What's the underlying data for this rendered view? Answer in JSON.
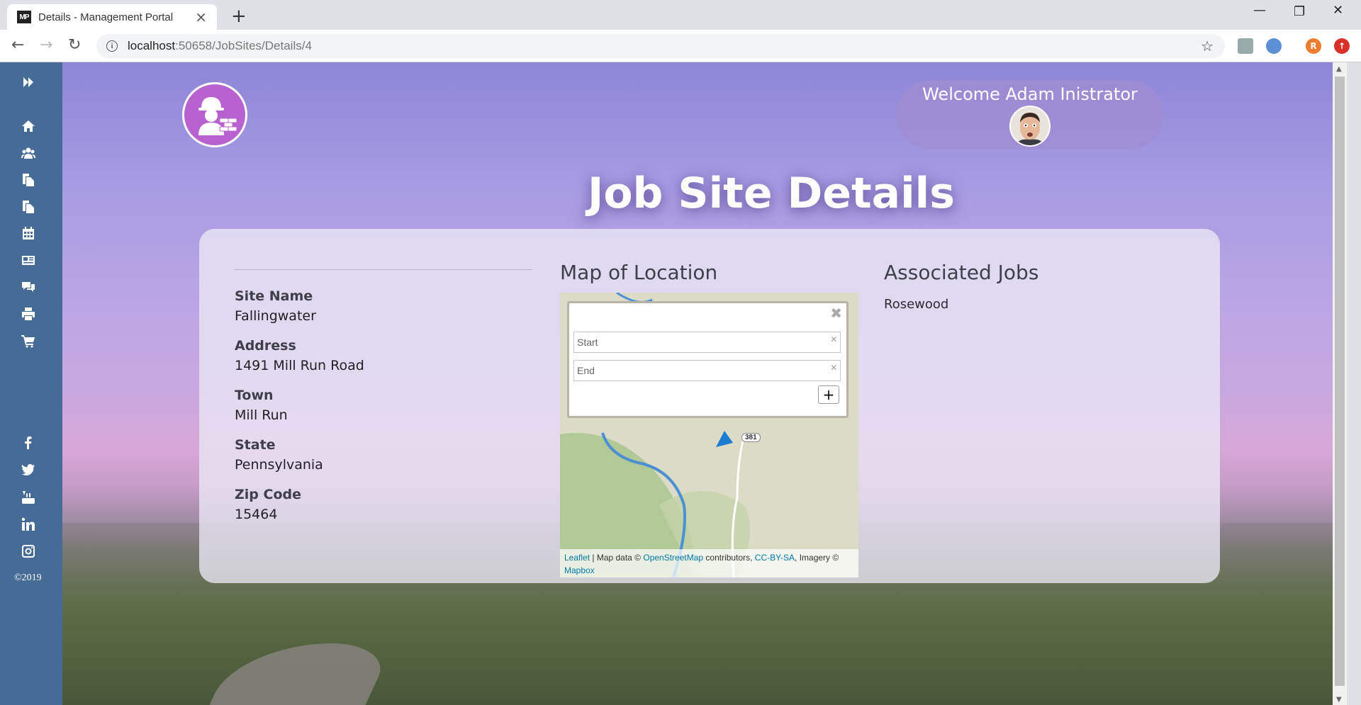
{
  "browser": {
    "tab_title": "Details - Management Portal",
    "favicon_text": "MP",
    "url_host": "localhost",
    "url_rest": ":50658/JobSites/Details/4",
    "profile_initial": "R"
  },
  "sidebar": {
    "items": [
      {
        "icon": "chevron-double-right-icon"
      },
      {
        "icon": "home-icon"
      },
      {
        "icon": "users-icon"
      },
      {
        "icon": "copy-icon"
      },
      {
        "icon": "copy-icon"
      },
      {
        "icon": "calendar-icon"
      },
      {
        "icon": "newspaper-icon"
      },
      {
        "icon": "comments-icon"
      },
      {
        "icon": "print-icon"
      },
      {
        "icon": "cart-icon"
      }
    ],
    "social": [
      "facebook-icon",
      "twitter-icon",
      "youtube-icon",
      "linkedin-icon",
      "instagram-icon"
    ],
    "copyright": "©2019"
  },
  "header": {
    "welcome": "Welcome Adam Inistrator"
  },
  "page": {
    "title": "Job Site Details"
  },
  "details": {
    "fields": [
      {
        "label": "Site Name",
        "value": "Fallingwater"
      },
      {
        "label": "Address",
        "value": "1491 Mill Run Road"
      },
      {
        "label": "Town",
        "value": "Mill Run"
      },
      {
        "label": "State",
        "value": "Pennsylvania"
      },
      {
        "label": "Zip Code",
        "value": "15464"
      }
    ]
  },
  "map": {
    "heading": "Map of Location",
    "start_placeholder": "Start",
    "end_placeholder": "End",
    "road_label": "381",
    "attribution": {
      "leaflet": "Leaflet",
      "sep": " | Map data © ",
      "osm": "OpenStreetMap",
      "contributors": " contributors, ",
      "license": "CC-BY-SA",
      "imagery": ", Imagery © ",
      "mapbox": "Mapbox"
    }
  },
  "jobs": {
    "heading": "Associated Jobs",
    "items": [
      "Rosewood"
    ]
  },
  "colors": {
    "sidebar": "#466b97",
    "logo": "#b862cf",
    "link": "#0078a8"
  }
}
